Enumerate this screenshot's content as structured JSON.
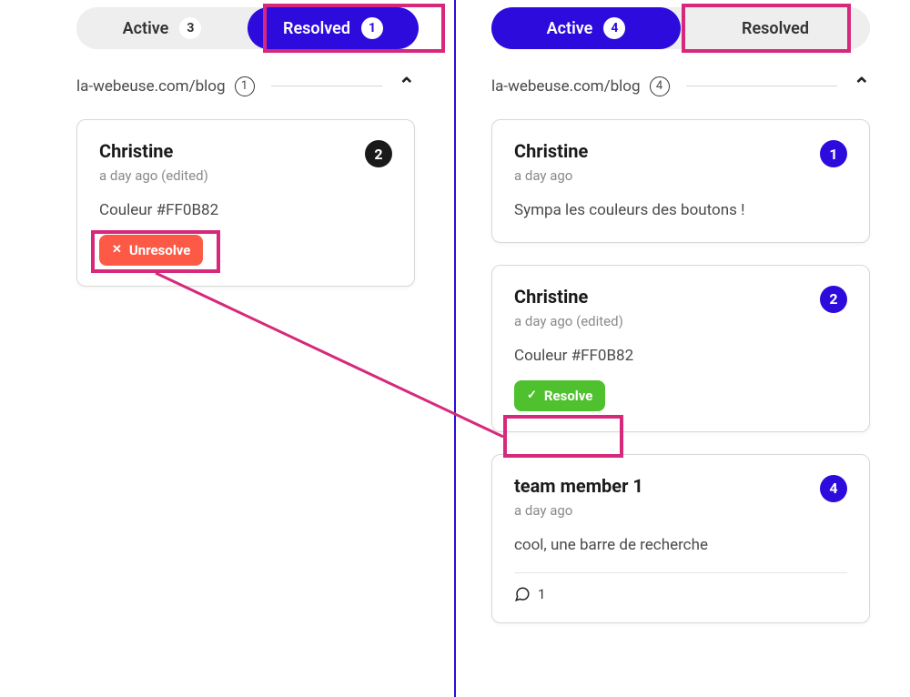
{
  "left": {
    "tabs": {
      "active": {
        "label": "Active",
        "count": "3"
      },
      "resolved": {
        "label": "Resolved",
        "count": "1"
      }
    },
    "breadcrumb": {
      "path": "la-webeuse.com/blog",
      "count": "1"
    },
    "card1": {
      "name": "Christine",
      "meta": "a day ago (edited)",
      "body": "Couleur #FF0B82",
      "badge": "2",
      "btn": "Unresolve"
    }
  },
  "right": {
    "tabs": {
      "active": {
        "label": "Active",
        "count": "4"
      },
      "resolved": {
        "label": "Resolved"
      }
    },
    "breadcrumb": {
      "path": "la-webeuse.com/blog",
      "count": "4"
    },
    "card1": {
      "name": "Christine",
      "meta": "a day ago",
      "body": "Sympa les couleurs des boutons !",
      "badge": "1"
    },
    "card2": {
      "name": "Christine",
      "meta": "a day ago (edited)",
      "body": "Couleur #FF0B82",
      "badge": "2",
      "btn": "Resolve"
    },
    "card3": {
      "name": "team member 1",
      "meta": "a day ago",
      "body": "cool, une barre de recherche",
      "badge": "4",
      "replies": "1"
    }
  }
}
